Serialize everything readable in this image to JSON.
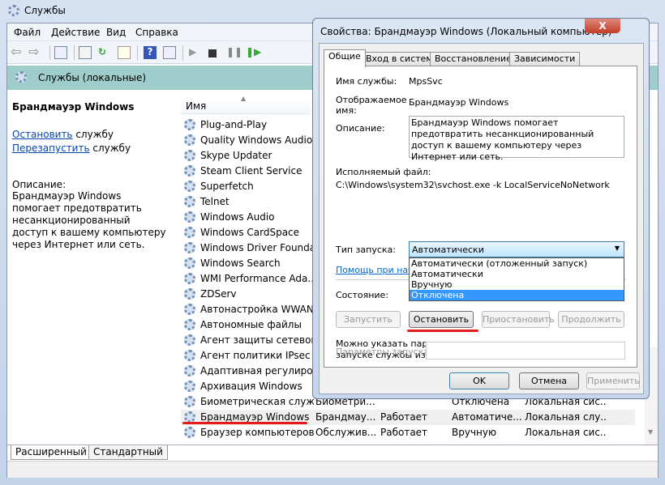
{
  "window": {
    "title": "Службы"
  },
  "menu": [
    "Файл",
    "Действие",
    "Вид",
    "Справка"
  ],
  "band_title": "Службы (локальные)",
  "left": {
    "title": "Брандмауэр Windows",
    "stop_link": "Остановить",
    "stop_rest": " службу",
    "restart_link": "Перезапустить",
    "restart_rest": " службу",
    "desc_label": "Описание:",
    "desc": "Брандмауэр Windows помогает предотвратить несанкционированный доступ к вашему компьютеру через Интернет или сеть."
  },
  "list": {
    "header_name": "Имя",
    "rows": [
      {
        "name": "Plug-and-Play"
      },
      {
        "name": "Quality Windows Audio..."
      },
      {
        "name": "Skype Updater"
      },
      {
        "name": "Steam Client Service"
      },
      {
        "name": "Superfetch"
      },
      {
        "name": "Telnet"
      },
      {
        "name": "Windows Audio"
      },
      {
        "name": "Windows CardSpace"
      },
      {
        "name": "Windows Driver Founda..."
      },
      {
        "name": "Windows Search"
      },
      {
        "name": "WMI Performance Ada..."
      },
      {
        "name": "ZDServ"
      },
      {
        "name": "Автонастройка WWAN"
      },
      {
        "name": "Автономные файлы"
      },
      {
        "name": "Агент защиты сетевог..."
      },
      {
        "name": "Агент политики IPsec"
      },
      {
        "name": "Адаптивная регулиров..."
      },
      {
        "name": "Архивация Windows"
      },
      {
        "name": "Биометрическая служ...",
        "desc": "Биометри...",
        "status": "",
        "startup": "Отключена",
        "logon": "Локальная сис..."
      },
      {
        "name": "Брандмауэр Windows",
        "desc": "Брандмау...",
        "status": "Работает",
        "startup": "Автоматиче...",
        "logon": "Локальная слу..."
      },
      {
        "name": "Браузер компьютеров",
        "desc": "Обслужив...",
        "status": "Работает",
        "startup": "Вручную",
        "logon": "Локальная сис..."
      }
    ]
  },
  "bottom_tabs": [
    "Расширенный",
    "Стандартный"
  ],
  "dialog": {
    "title": "Свойства: Брандмауэр Windows (Локальный компьютер)",
    "close": "X",
    "tabs": [
      "Общие",
      "Вход в систему",
      "Восстановление",
      "Зависимости"
    ],
    "service_name_label": "Имя службы:",
    "service_name": "MpsSvc",
    "display_name_label": "Отображаемое имя:",
    "display_name": "Брандмауэр Windows",
    "desc_label": "Описание:",
    "desc": "Брандмауэр Windows помогает предотвратить несанкционированный доступ к вашему компьютеру через Интернет или сеть.",
    "exe_label": "Исполняемый файл:",
    "exe": "C:\\Windows\\system32\\svchost.exe -k LocalServiceNoNetwork",
    "startup_label": "Тип запуска:",
    "startup_value": "Автоматически",
    "startup_options": [
      "Автоматически (отложенный запуск)",
      "Автоматически",
      "Вручную",
      "Отключена"
    ],
    "help_link": "Помощь при наст",
    "state_label": "Состояние:",
    "buttons": {
      "start": "Запустить",
      "stop": "Остановить",
      "pause": "Приостановить",
      "resume": "Продолжить"
    },
    "params_note": "Можно указать параметры запуска, применяемые при запуске службы из этого диалогового окна.",
    "params_label": "Параметры запуска:",
    "params_value": "",
    "ok": "OK",
    "cancel": "Отмена",
    "apply": "Применить"
  }
}
